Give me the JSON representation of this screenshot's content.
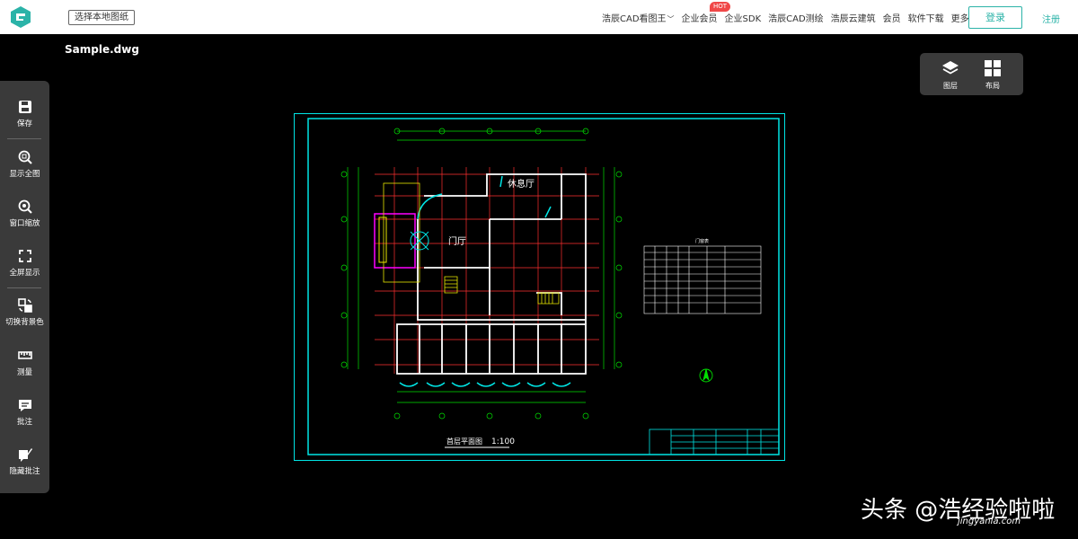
{
  "header": {
    "local_btn": "选择本地图纸",
    "nav": [
      "浩辰CAD看图王",
      "企业会员",
      "企业SDK",
      "浩辰CAD测绘",
      "浩辰云建筑",
      "会员",
      "软件下载",
      "更多"
    ],
    "hot_badge": "HOT",
    "login": "登录",
    "register": "注册"
  },
  "file": {
    "name": "Sample.dwg"
  },
  "sidebar": {
    "tools": [
      {
        "label": "保存",
        "icon": "save-icon"
      },
      {
        "label": "显示全图",
        "icon": "zoom-all-icon"
      },
      {
        "label": "窗口缩放",
        "icon": "zoom-window-icon"
      },
      {
        "label": "全屏显示",
        "icon": "fullscreen-icon"
      },
      {
        "label": "切换背景色",
        "icon": "switch-background-icon"
      },
      {
        "label": "测量",
        "icon": "ruler-icon"
      },
      {
        "label": "批注",
        "icon": "comment-icon"
      },
      {
        "label": "隐藏批注",
        "icon": "hide-comment-icon"
      }
    ]
  },
  "panel": {
    "layers": "图层",
    "layout": "布局"
  },
  "drawing": {
    "room_lounge": "休息厅",
    "room_hall": "门厅",
    "plan_title": "首层平面图",
    "scale": "1:100",
    "door_window_table_title": "门窗表"
  },
  "watermark": {
    "text": "头条 @浩经验啦啦",
    "url": "jingyanla.com"
  },
  "colors": {
    "accent": "#2bb3a8",
    "cad_cyan": "#00e5e5",
    "cad_red": "#ff3030",
    "cad_green": "#00e000",
    "cad_yellow": "#e8e800",
    "cad_magenta": "#ff00ff"
  }
}
